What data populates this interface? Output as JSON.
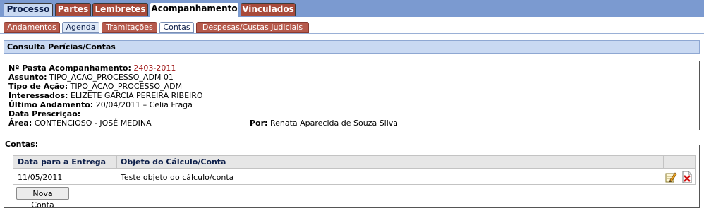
{
  "top_tabs": [
    {
      "label": "Processo",
      "style": "blue"
    },
    {
      "label": "Partes",
      "style": "red"
    },
    {
      "label": "Lembretes",
      "style": "red"
    },
    {
      "label": "Acompanhamento",
      "style": "active"
    },
    {
      "label": "Vinculados",
      "style": "red"
    }
  ],
  "sub_tabs": [
    {
      "label": "Andamentos",
      "style": "red"
    },
    {
      "label": "Agenda",
      "style": "blue"
    },
    {
      "label": "Tramitações",
      "style": "red"
    },
    {
      "label": "Contas",
      "style": "white"
    },
    {
      "label": "Despesas/Custas Judiciais",
      "style": "red"
    }
  ],
  "section_title": "Consulta Perícias/Contas",
  "info": {
    "pasta_label": "Nº Pasta Acompanhamento:",
    "pasta_value": "2403-2011",
    "assunto_label": "Assunto:",
    "assunto_value": "TIPO_ACAO_PROCESSO_ADM 01",
    "tipo_label": "Tipo de Ação:",
    "tipo_value": "TIPO_ACAO_PROCESSO_ADM",
    "interessados_label": "Interessados:",
    "interessados_value": "ELIZETE GARCIA PEREIRA RIBEIRO",
    "ultimo_label": "Último Andamento:",
    "ultimo_value": "20/04/2011 – Celia Fraga",
    "prescricao_label": "Data Prescrição:",
    "prescricao_value": "",
    "area_label": "Área:",
    "area_value": "CONTENCIOSO - JOSÉ MEDINA",
    "por_label": "Por:",
    "por_value": "Renata Aparecida de Souza Silva"
  },
  "contas": {
    "legend": "Contas:",
    "columns": [
      "Data para a Entrega",
      "Objeto do Cálculo/Conta"
    ],
    "rows": [
      {
        "data": "11/05/2011",
        "objeto": "Teste objeto do cálculo/conta"
      }
    ],
    "button_label": "Nova Conta"
  },
  "colors": {
    "topbar": "#7b9ad0",
    "tab_red": "#a84a3a",
    "tab_blue": "#c9d9f2",
    "accent_value": "#a01818"
  },
  "icons": [
    "edit-icon",
    "delete-icon"
  ]
}
